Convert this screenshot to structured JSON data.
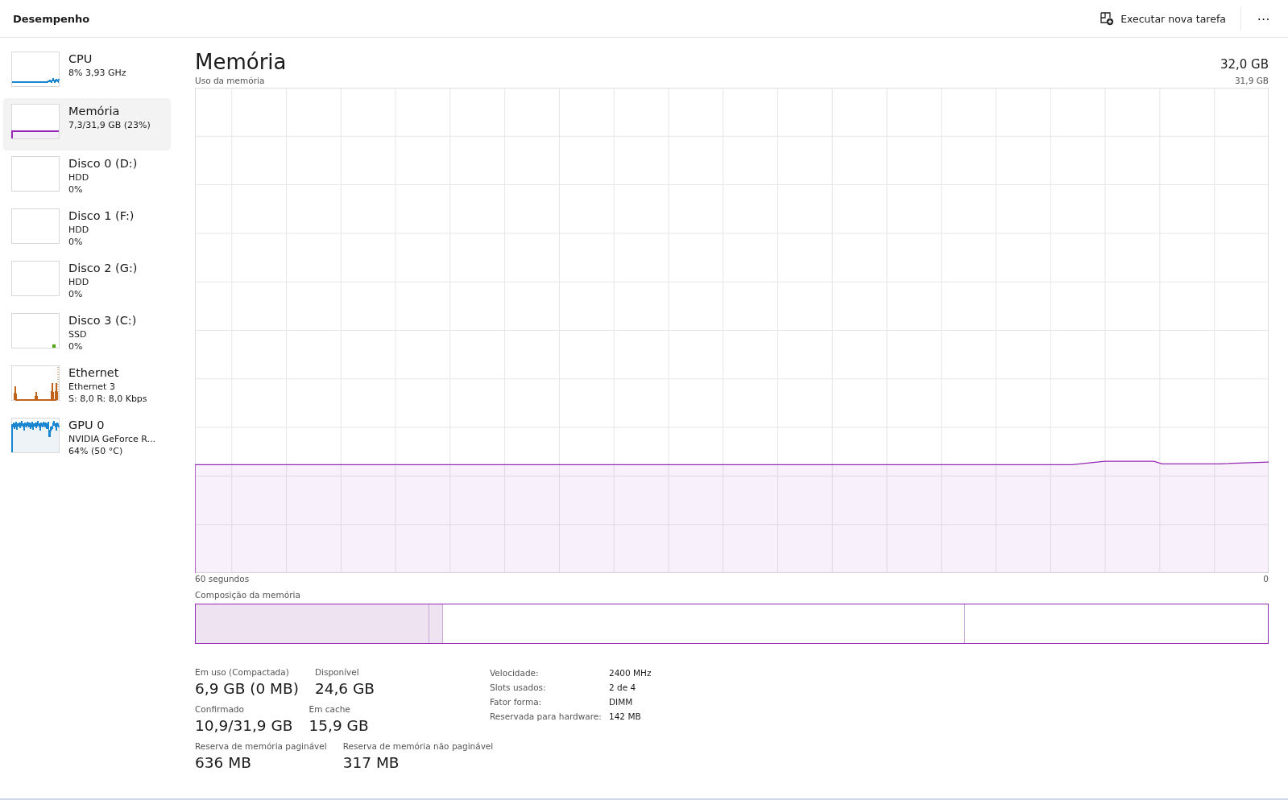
{
  "header": {
    "title": "Desempenho",
    "run_task": "Executar nova tarefa",
    "more": "⋯"
  },
  "sidebar": {
    "items": [
      {
        "kind": "cpu",
        "title": "CPU",
        "lines": [
          "8%  3,93 GHz"
        ],
        "color": "#1a86d0",
        "selected": false
      },
      {
        "kind": "memory",
        "title": "Memória",
        "lines": [
          "7,3/31,9 GB (23%)"
        ],
        "color": "#9528b4",
        "selected": true
      },
      {
        "kind": "disk",
        "title": "Disco 0 (D:)",
        "lines": [
          "HDD",
          "0%"
        ],
        "selected": false
      },
      {
        "kind": "disk",
        "title": "Disco 1 (F:)",
        "lines": [
          "HDD",
          "0%"
        ],
        "selected": false
      },
      {
        "kind": "disk",
        "title": "Disco 2 (G:)",
        "lines": [
          "HDD",
          "0%"
        ],
        "selected": false
      },
      {
        "kind": "disk-blip",
        "title": "Disco 3 (C:)",
        "lines": [
          "SSD",
          "0%"
        ],
        "color": "#4da60c",
        "selected": false
      },
      {
        "kind": "network",
        "title": "Ethernet",
        "lines": [
          "Ethernet 3",
          "S: 8,0  R: 8,0 Kbps"
        ],
        "color": "#c0621a",
        "selected": false
      },
      {
        "kind": "gpu",
        "title": "GPU 0",
        "lines": [
          "NVIDIA GeForce R...",
          "64%  (50 °C)"
        ],
        "color": "#1a86d0",
        "selected": false
      }
    ]
  },
  "main": {
    "title": "Memória",
    "total": "32,0 GB",
    "chart_label": "Uso da memória",
    "chart_max": "31,9 GB",
    "time_label": "60 segundos",
    "chart_min": "0",
    "composition_label": "Composição da memória",
    "composition": [
      {
        "kind": "used",
        "level": 0.217
      },
      {
        "kind": "modified",
        "level": 0.013
      },
      {
        "kind": "standby",
        "level": 0.487
      },
      {
        "kind": "free",
        "level": 0.283
      }
    ],
    "stats": [
      [
        {
          "label": "Em uso (Compactada)",
          "value": "6,9 GB (0 MB)"
        },
        {
          "label": "Disponível",
          "value": "24,6 GB"
        }
      ],
      [
        {
          "label": "Confirmado",
          "value": "10,9/31,9 GB"
        },
        {
          "label": "Em cache",
          "value": "15,9 GB"
        }
      ],
      [
        {
          "label": "Reserva de memória paginável",
          "value": "636 MB"
        },
        {
          "label": "Reserva de memória não paginável",
          "value": "317 MB"
        }
      ]
    ],
    "properties": [
      {
        "key": "Velocidade:",
        "value": "2400 MHz"
      },
      {
        "key": "Slots usados:",
        "value": "2 de 4"
      },
      {
        "key": "Fator forma:",
        "value": "DIMM"
      },
      {
        "key": "Reservada para hardware:",
        "value": "142 MB"
      }
    ]
  }
}
